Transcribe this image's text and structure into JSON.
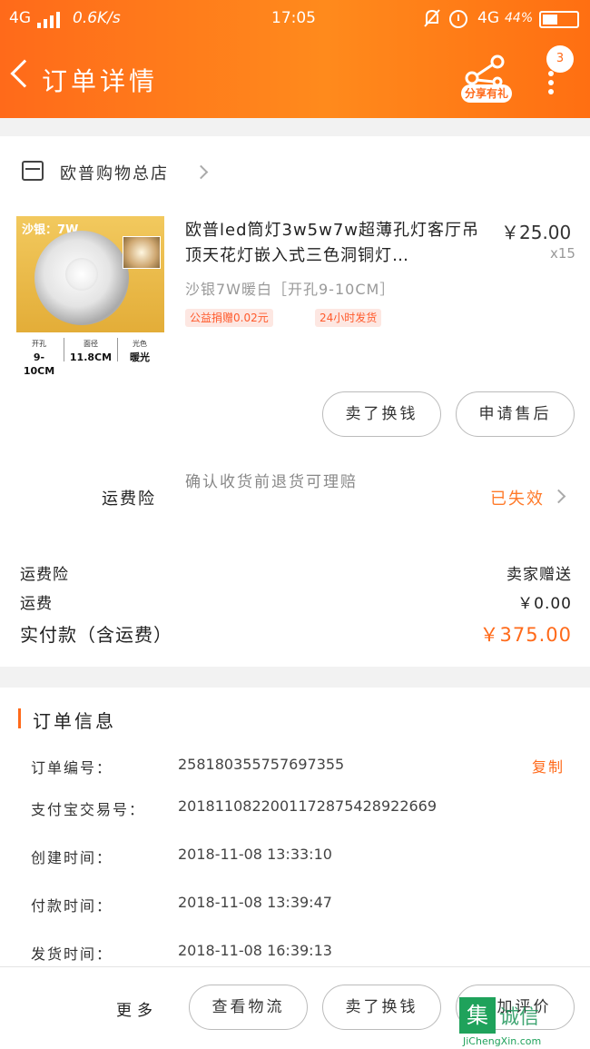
{
  "status_bar": {
    "network": "4G",
    "speed": "0.6K/s",
    "time": "17:05",
    "network_right": "4G",
    "battery": "44%"
  },
  "header": {
    "title": "订单详情",
    "share_label": "分享有礼",
    "message_count": "3"
  },
  "store": {
    "name": "欧普购物总店"
  },
  "product": {
    "image": {
      "tag": "沙银：7W",
      "specs": [
        {
          "label": "开孔",
          "value": "9-10CM"
        },
        {
          "label": "面径",
          "value": "11.8CM"
        },
        {
          "label": "光色",
          "value": "暖光"
        }
      ]
    },
    "title": "欧普led筒灯3w5w7w超薄孔灯客厅吊顶天花灯嵌入式三色洞铜灯…",
    "price": "￥25.00",
    "quantity": "x15",
    "sku": "沙银7W暖白［开孔9-10CM］",
    "tags": [
      "公益捐赠0.02元",
      "24小时发货"
    ],
    "buttons": {
      "resell": "卖了换钱",
      "after_sale": "申请售后"
    }
  },
  "insurance": {
    "label": "运费险",
    "description": "确认收货前退货可理赔",
    "status": "已失效"
  },
  "summary": {
    "insurance_label": "运费险",
    "insurance_value": "卖家赠送",
    "shipping_label": "运费",
    "shipping_value": "￥0.00",
    "paid_label": "实付款（含运费）",
    "paid_value": "￥375.00"
  },
  "order_info": {
    "section_title": "订单信息",
    "copy_label": "复制",
    "rows": [
      {
        "label": "订单编号：",
        "value": "258180355757697355"
      },
      {
        "label": "支付宝交易号：",
        "value": "2018110822001172875428922669"
      },
      {
        "label": "创建时间：",
        "value": "2018-11-08 13:33:10"
      },
      {
        "label": "付款时间：",
        "value": "2018-11-08 13:39:47"
      },
      {
        "label": "发货时间：",
        "value": "2018-11-08 16:39:13"
      }
    ]
  },
  "bottom_bar": {
    "more": "更多",
    "view_logistics": "查看物流",
    "resell": "卖了换钱",
    "add_review": "追加评价"
  },
  "watermark": {
    "text": "诚信",
    "url": "JiChengXin.com"
  },
  "colors": {
    "accent": "#ff6a1a",
    "status_orange": "#ff7a2a"
  }
}
